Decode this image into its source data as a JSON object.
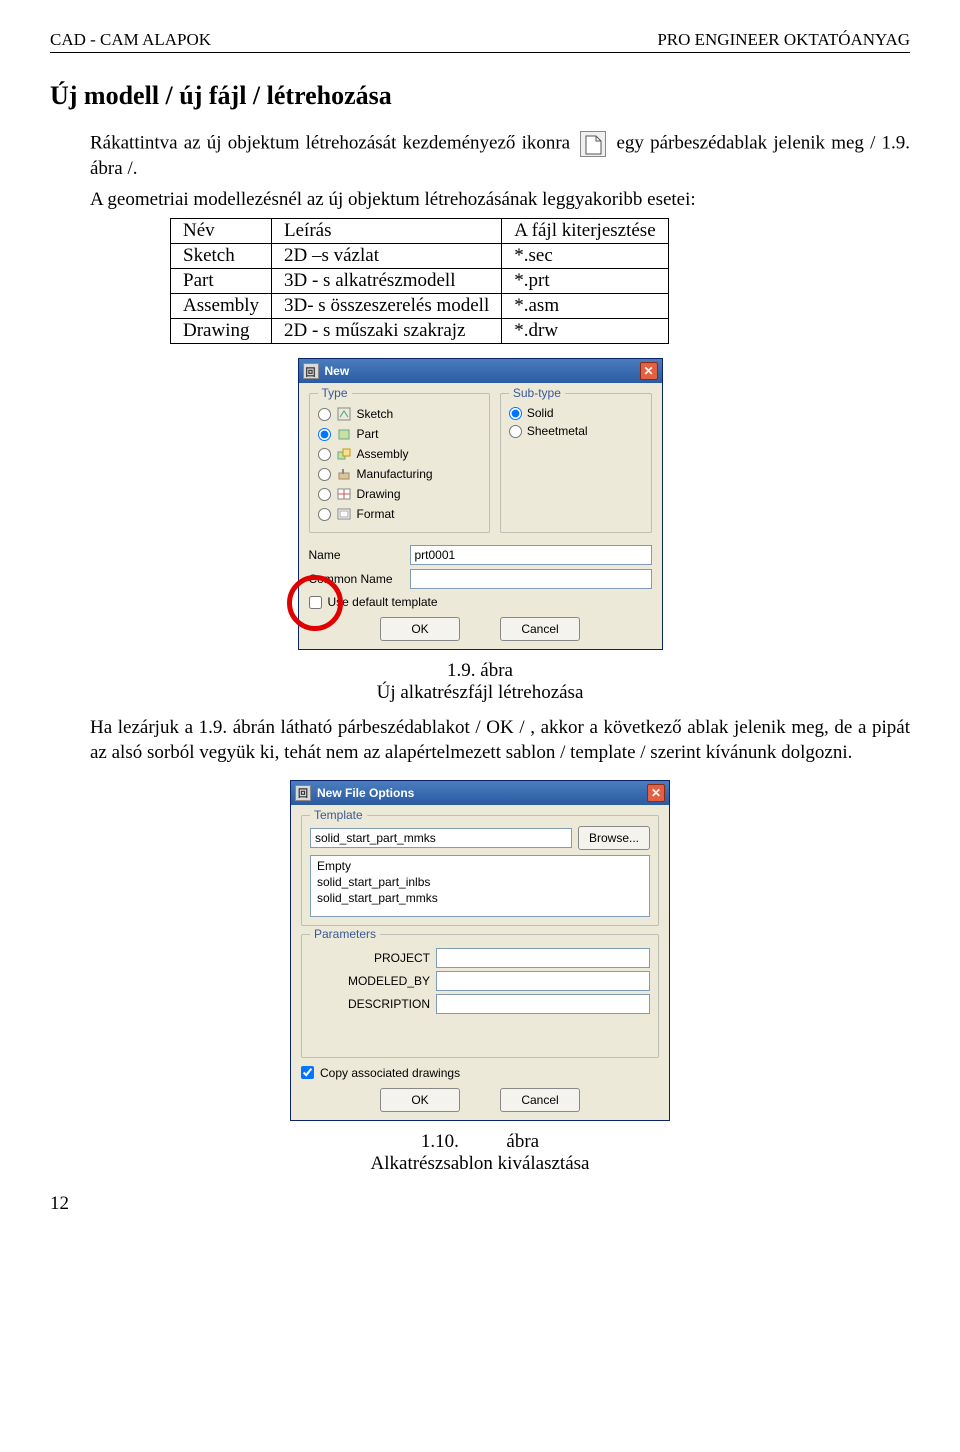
{
  "header": {
    "left": "CAD - CAM ALAPOK",
    "right": "PRO ENGINEER OKTATÓANYAG"
  },
  "section_title": "Új modell / új fájl / létrehozása",
  "para1a": "Rákattintva az új objektum létrehozását kezdeményező ikonra",
  "para1b": "egy párbeszédablak jelenik meg / 1.9. ábra /.",
  "para2": "A geometriai modellezésnél az új objektum létrehozásának leggyakoribb esetei:",
  "table": {
    "headers": [
      "Név",
      "Leírás",
      "A fájl kiterjesztése"
    ],
    "rows": [
      [
        "Sketch",
        "2D –s vázlat",
        "*.sec"
      ],
      [
        "Part",
        "3D - s alkatrészmodell",
        "*.prt"
      ],
      [
        "Assembly",
        "3D- s összeszerelés modell",
        "*.asm"
      ],
      [
        "Drawing",
        "2D - s műszaki szakrajz",
        "*.drw"
      ]
    ]
  },
  "dialog1": {
    "title": "New",
    "group_type": "Type",
    "group_sub": "Sub-type",
    "types": [
      "Sketch",
      "Part",
      "Assembly",
      "Manufacturing",
      "Drawing",
      "Format"
    ],
    "type_selected": 1,
    "subtypes": [
      "Solid",
      "Sheetmetal"
    ],
    "sub_selected": 0,
    "name_label": "Name",
    "name_value": "prt0001",
    "common_label": "Common Name",
    "common_value": "",
    "use_default": "Use default template",
    "ok": "OK",
    "cancel": "Cancel"
  },
  "caption1": {
    "line1": "1.9. ábra",
    "line2": "Új alkatrészfájl létrehozása"
  },
  "para3": "Ha lezárjuk a 1.9. ábrán látható párbeszédablakot / OK / , akkor a következő ablak jelenik meg, de a pipát az alsó sorból vegyük ki, tehát nem az alapértelmezett sablon / template / szerint kívánunk dolgozni.",
  "dialog2": {
    "title": "New File Options",
    "group_tpl": "Template",
    "tpl_value": "solid_start_part_mmks",
    "browse": "Browse...",
    "list": [
      "Empty",
      "solid_start_part_inlbs",
      "solid_start_part_mmks"
    ],
    "group_param": "Parameters",
    "params": [
      "PROJECT",
      "MODELED_BY",
      "DESCRIPTION"
    ],
    "copy_assoc": "Copy associated drawings",
    "ok": "OK",
    "cancel": "Cancel"
  },
  "caption2": {
    "line1": "1.10.          ábra",
    "line2": "Alkatrészsablon kiválasztása"
  },
  "page_number": "12"
}
